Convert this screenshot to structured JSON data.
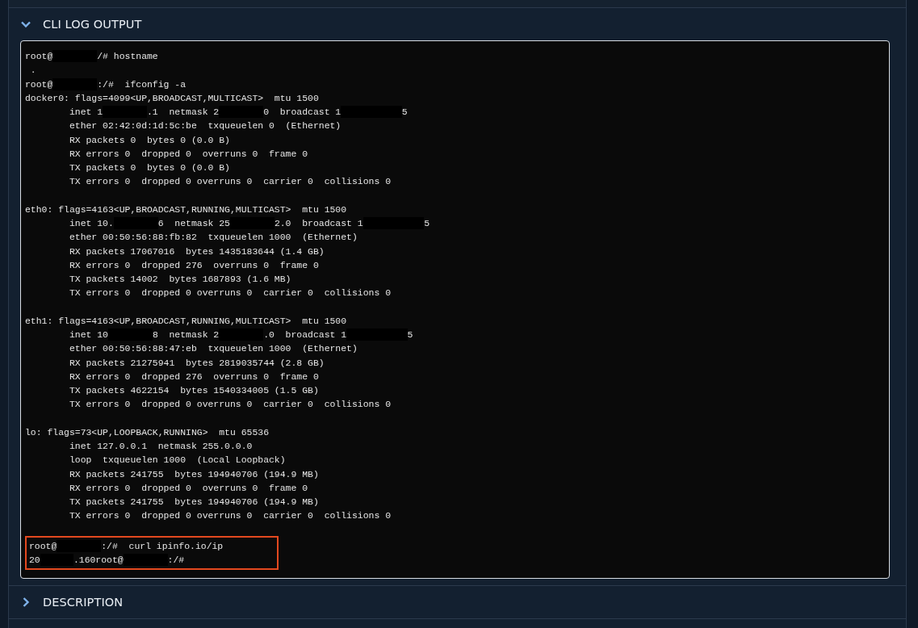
{
  "sections": [
    {
      "title": "CLI LOG OUTPUT",
      "expanded": true
    },
    {
      "title": "DESCRIPTION",
      "expanded": false
    }
  ],
  "terminal": {
    "blocks": [
      [
        [
          {
            "kind": "text",
            "text": "root@"
          },
          {
            "kind": "mask"
          },
          {
            "kind": "text",
            "text": "/# hostname"
          }
        ],
        [
          {
            "kind": "text",
            "text": " ."
          }
        ],
        [
          {
            "kind": "text",
            "text": "root@"
          },
          {
            "kind": "mask"
          },
          {
            "kind": "text",
            "text": ":/#  ifconfig -a"
          }
        ],
        [
          {
            "kind": "text",
            "text": "docker0: flags=4099<UP,BROADCAST,MULTICAST>  mtu 1500"
          }
        ],
        [
          {
            "kind": "text",
            "text": "        inet 1"
          },
          {
            "kind": "mask"
          },
          {
            "kind": "text",
            "text": ".1  netmask 2"
          },
          {
            "kind": "mask"
          },
          {
            "kind": "text",
            "text": "0  broadcast 1"
          },
          {
            "kind": "mask-long"
          },
          {
            "kind": "text",
            "text": "5"
          }
        ],
        [
          {
            "kind": "text",
            "text": "        ether 02:42:0d:1d:5c:be  txqueuelen 0  (Ethernet)"
          }
        ],
        [
          {
            "kind": "text",
            "text": "        RX packets 0  bytes 0 (0.0 B)"
          }
        ],
        [
          {
            "kind": "text",
            "text": "        RX errors 0  dropped 0  overruns 0  frame 0"
          }
        ],
        [
          {
            "kind": "text",
            "text": "        TX packets 0  bytes 0 (0.0 B)"
          }
        ],
        [
          {
            "kind": "text",
            "text": "        TX errors 0  dropped 0 overruns 0  carrier 0  collisions 0"
          }
        ]
      ],
      [
        [
          {
            "kind": "text",
            "text": "eth0: flags=4163<UP,BROADCAST,RUNNING,MULTICAST>  mtu 1500"
          }
        ],
        [
          {
            "kind": "text",
            "text": "        inet 10."
          },
          {
            "kind": "mask"
          },
          {
            "kind": "text",
            "text": "6  netmask 25"
          },
          {
            "kind": "mask"
          },
          {
            "kind": "text",
            "text": "2.0  broadcast 1"
          },
          {
            "kind": "mask-long"
          },
          {
            "kind": "text",
            "text": "5"
          }
        ],
        [
          {
            "kind": "text",
            "text": "        ether 00:50:56:88:fb:82  txqueuelen 1000  (Ethernet)"
          }
        ],
        [
          {
            "kind": "text",
            "text": "        RX packets 17067016  bytes 1435183644 (1.4 GB)"
          }
        ],
        [
          {
            "kind": "text",
            "text": "        RX errors 0  dropped 276  overruns 0  frame 0"
          }
        ],
        [
          {
            "kind": "text",
            "text": "        TX packets 14002  bytes 1687893 (1.6 MB)"
          }
        ],
        [
          {
            "kind": "text",
            "text": "        TX errors 0  dropped 0 overruns 0  carrier 0  collisions 0"
          }
        ]
      ],
      [
        [
          {
            "kind": "text",
            "text": "eth1: flags=4163<UP,BROADCAST,RUNNING,MULTICAST>  mtu 1500"
          }
        ],
        [
          {
            "kind": "text",
            "text": "        inet 10"
          },
          {
            "kind": "mask"
          },
          {
            "kind": "text",
            "text": "8  netmask 2"
          },
          {
            "kind": "mask"
          },
          {
            "kind": "text",
            "text": ".0  broadcast 1"
          },
          {
            "kind": "mask-long"
          },
          {
            "kind": "text",
            "text": "5"
          }
        ],
        [
          {
            "kind": "text",
            "text": "        ether 00:50:56:88:47:eb  txqueuelen 1000  (Ethernet)"
          }
        ],
        [
          {
            "kind": "text",
            "text": "        RX packets 21275941  bytes 2819035744 (2.8 GB)"
          }
        ],
        [
          {
            "kind": "text",
            "text": "        RX errors 0  dropped 276  overruns 0  frame 0"
          }
        ],
        [
          {
            "kind": "text",
            "text": "        TX packets 4622154  bytes 1540334005 (1.5 GB)"
          }
        ],
        [
          {
            "kind": "text",
            "text": "        TX errors 0  dropped 0 overruns 0  carrier 0  collisions 0"
          }
        ]
      ],
      [
        [
          {
            "kind": "text",
            "text": "lo: flags=73<UP,LOOPBACK,RUNNING>  mtu 65536"
          }
        ],
        [
          {
            "kind": "text",
            "text": "        inet 127.0.0.1  netmask 255.0.0.0"
          }
        ],
        [
          {
            "kind": "text",
            "text": "        loop  txqueuelen 1000  (Local Loopback)"
          }
        ],
        [
          {
            "kind": "text",
            "text": "        RX packets 241755  bytes 194940706 (194.9 MB)"
          }
        ],
        [
          {
            "kind": "text",
            "text": "        RX errors 0  dropped 0  overruns 0  frame 0"
          }
        ],
        [
          {
            "kind": "text",
            "text": "        TX packets 241755  bytes 194940706 (194.9 MB)"
          }
        ],
        [
          {
            "kind": "text",
            "text": "        TX errors 0  dropped 0 overruns 0  carrier 0  collisions 0"
          }
        ]
      ]
    ],
    "highlighted_lines": [
      [
        {
          "kind": "text",
          "text": "root@"
        },
        {
          "kind": "mask"
        },
        {
          "kind": "text",
          "text": ":/#  curl ipinfo.io/ip"
        }
      ],
      [
        {
          "kind": "text",
          "text": "20"
        },
        {
          "kind": "mask-short"
        },
        {
          "kind": "text",
          "text": ".160root@"
        },
        {
          "kind": "mask"
        },
        {
          "kind": "text",
          "text": ":/#"
        }
      ]
    ]
  }
}
